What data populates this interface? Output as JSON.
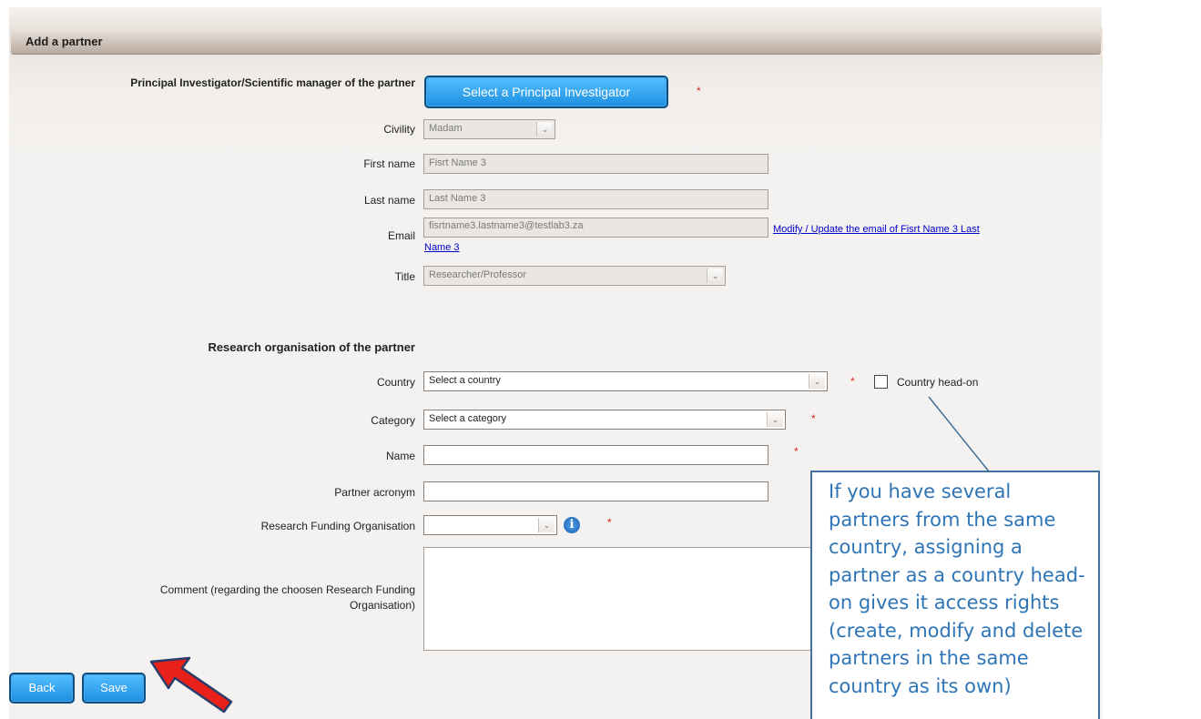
{
  "header": {
    "title": "Add a partner"
  },
  "pi": {
    "label": "Principal Investigator/Scientific manager of the partner",
    "select_button": "Select a Principal Investigator",
    "required": "*"
  },
  "civility": {
    "label": "Civility",
    "value": "Madam"
  },
  "first_name": {
    "label": "First name",
    "value": "Fisrt Name 3"
  },
  "last_name": {
    "label": "Last name",
    "value": "Last Name 3"
  },
  "email": {
    "label": "Email",
    "value": "fisrtname3.lastname3@testlab3.za",
    "link_line1": "Modify / Update the email of Fisrt Name 3 Last",
    "link_line2": "Name 3"
  },
  "title_field": {
    "label": "Title",
    "value": "Researcher/Professor"
  },
  "org": {
    "heading": "Research organisation of the partner",
    "country_label": "Country",
    "country_value": "Select a country",
    "country_headon_label": "Country head-on",
    "category_label": "Category",
    "category_value": "Select a category",
    "name_label": "Name",
    "name_value": "",
    "acronym_label": "Partner acronym",
    "acronym_value": "",
    "rfo_label": "Research Funding Organisation",
    "rfo_value": "",
    "comment_label_line1": "Comment (regarding the choosen Research Funding",
    "comment_label_line2": "Organisation)",
    "required": "*"
  },
  "actions": {
    "back": "Back",
    "save": "Save"
  },
  "callout": {
    "text": "If you have several partners from the same country, assigning a partner as a country head-on gives it access rights (create, modify and delete partners in the same country as its own)"
  },
  "colors": {
    "button_blue": "#1e8ee0",
    "callout_text": "#2e75b6",
    "callout_border": "#41719c",
    "arrow_red": "#e8211a",
    "required_star": "#d7261e"
  },
  "icons": [
    "chevron-down-icon",
    "info-icon",
    "red-arrow-annotation"
  ]
}
